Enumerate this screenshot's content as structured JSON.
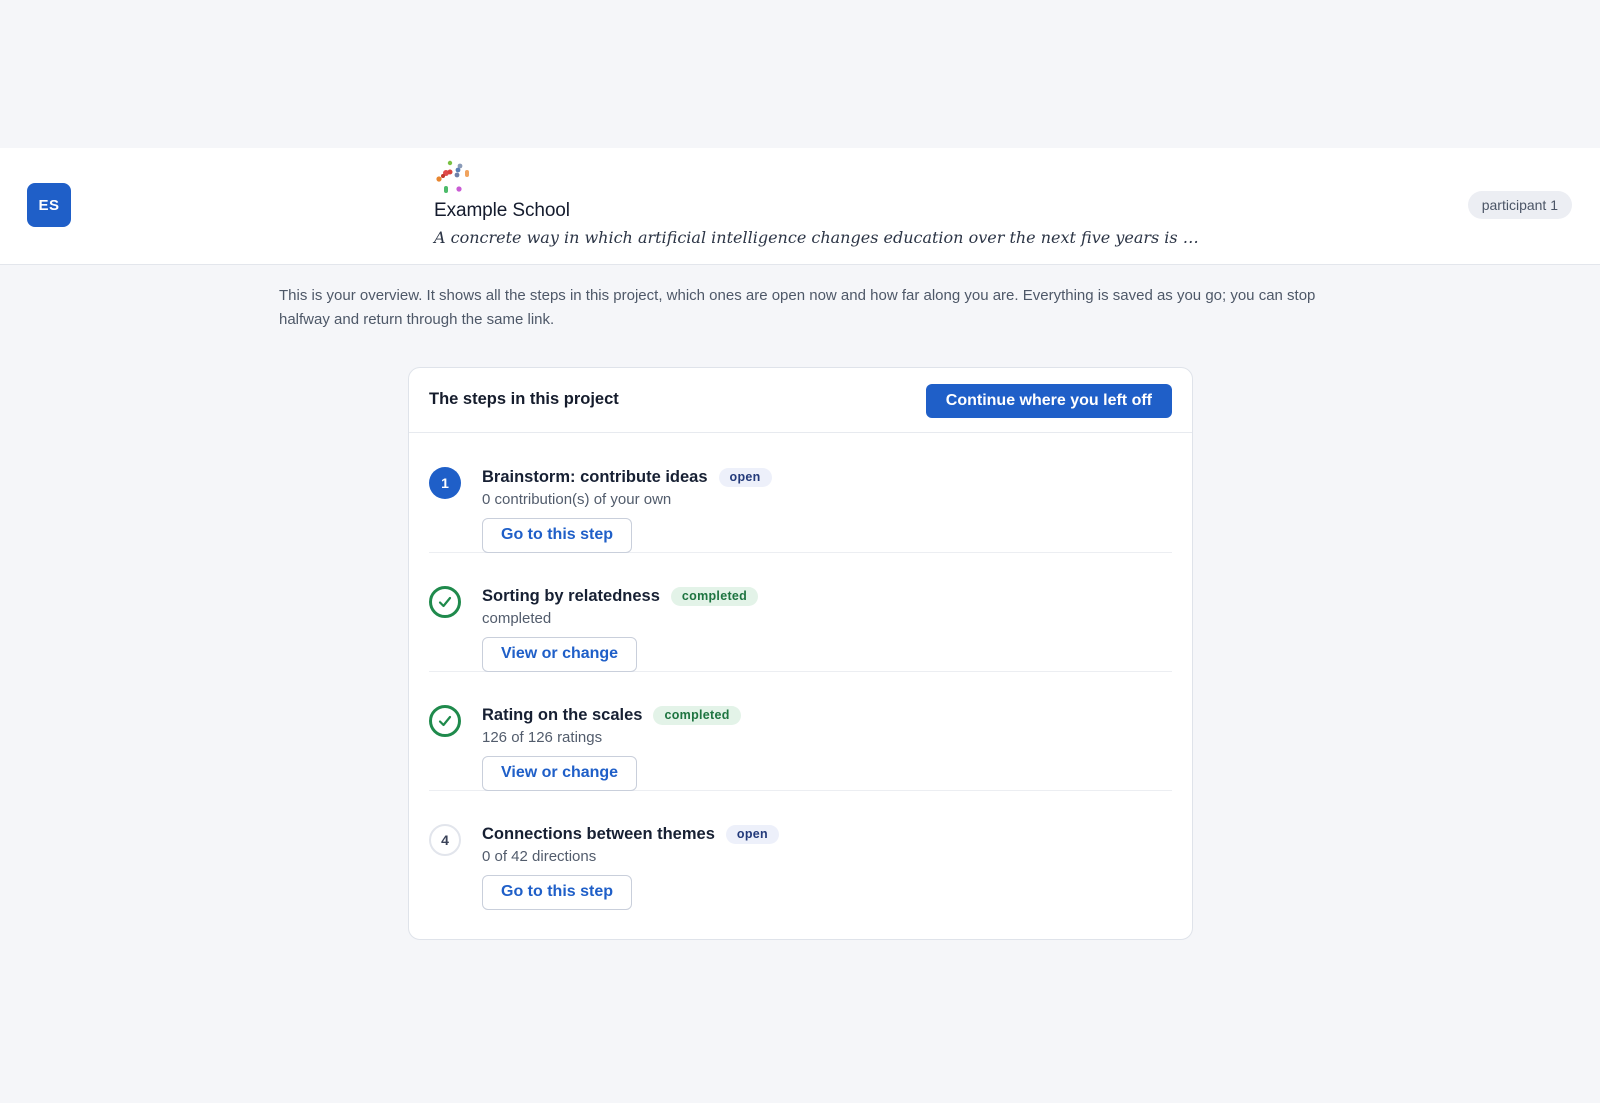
{
  "header": {
    "avatar_initials": "ES",
    "school_name": "Example School",
    "question": "A concrete way in which artificial intelligence changes education over the next five years is …",
    "participant_label": "participant 1",
    "logo_icon": "colorful-dots-logo-icon"
  },
  "intro_text": "This is your overview. It shows all the steps in this project, which ones are open now and how far along you are. Everything is saved as you go; you can stop halfway and return through the same link.",
  "card": {
    "title": "The steps in this project",
    "continue_label": "Continue where you left off"
  },
  "steps": [
    {
      "marker": "1",
      "marker_state": "active",
      "title": "Brainstorm: contribute ideas",
      "badge": "open",
      "subtitle": "0 contribution(s) of your own",
      "button_label": "Go to this step"
    },
    {
      "marker": "",
      "marker_state": "completed",
      "marker_icon": "check-icon",
      "title": "Sorting by relatedness",
      "badge": "completed",
      "subtitle": "completed",
      "button_label": "View or change"
    },
    {
      "marker": "",
      "marker_state": "completed",
      "marker_icon": "check-icon",
      "title": "Rating on the scales",
      "badge": "completed",
      "subtitle": "126 of 126 ratings",
      "button_label": "View or change"
    },
    {
      "marker": "4",
      "marker_state": "idle",
      "title": "Connections between themes",
      "badge": "open",
      "subtitle": "0 of 42 directions",
      "button_label": "Go to this step"
    }
  ],
  "colors": {
    "primary": "#1f5fc8",
    "success": "#1f8a4c",
    "background": "#f5f6f9"
  }
}
